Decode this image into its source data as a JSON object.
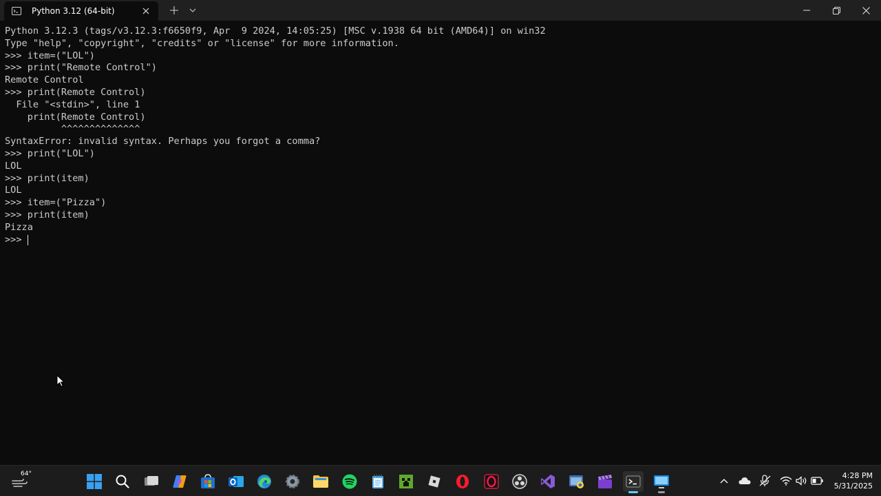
{
  "window": {
    "tab_title": "Python 3.12 (64-bit)",
    "icons": {
      "tab": "terminal-icon",
      "close_tab": "close-icon",
      "new_tab": "plus-icon",
      "dropdown": "chevron-down-icon",
      "minimize": "minimize-icon",
      "maximize": "restore-icon",
      "close": "close-icon"
    }
  },
  "terminal": {
    "lines": [
      "Python 3.12.3 (tags/v3.12.3:f6650f9, Apr  9 2024, 14:05:25) [MSC v.1938 64 bit (AMD64)] on win32",
      "Type \"help\", \"copyright\", \"credits\" or \"license\" for more information.",
      ">>> item=(\"LOL\")",
      ">>> print(\"Remote Control\")",
      "Remote Control",
      ">>> print(Remote Control)",
      "  File \"<stdin>\", line 1",
      "    print(Remote Control)",
      "          ^^^^^^^^^^^^^^",
      "SyntaxError: invalid syntax. Perhaps you forgot a comma?",
      ">>> print(\"LOL\")",
      "LOL",
      ">>> print(item)",
      "LOL",
      ">>> item=(\"Pizza\")",
      ">>> print(item)",
      "Pizza"
    ],
    "prompt": ">>> "
  },
  "taskbar": {
    "weather_temp": "64°",
    "apps": [
      "windows-start-icon",
      "search-icon",
      "task-view-icon",
      "copilot-icon",
      "microsoft-store-icon",
      "outlook-icon",
      "edge-icon",
      "settings-icon",
      "file-explorer-icon",
      "spotify-icon",
      "notepad-icon",
      "minecraft-icon",
      "roblox-icon",
      "opera-icon",
      "opera-gx-icon",
      "obs-icon",
      "visual-studio-icon",
      "python-icon",
      "clapperboard-icon",
      "windows-terminal-icon",
      "remote-desktop-icon"
    ],
    "tray": [
      "chevron-up-icon",
      "onedrive-icon",
      "microphone-icon",
      "wifi-icon",
      "volume-icon",
      "battery-icon"
    ],
    "time": "4:28 PM",
    "date": "5/31/2025"
  },
  "colors": {
    "terminal_bg": "#0c0c0c",
    "text": "#cccccc",
    "titlebar": "#202020",
    "taskbar": "#1c1c1c",
    "accent": "#60cdff"
  }
}
